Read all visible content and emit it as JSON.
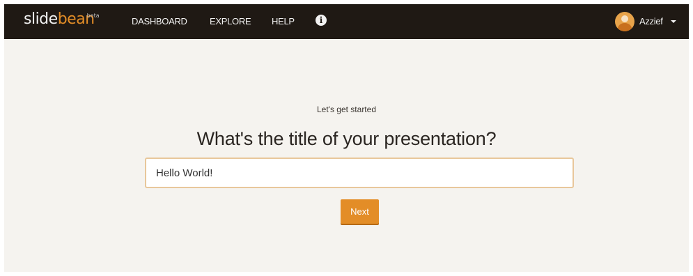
{
  "brand": {
    "logo_part1": "slide",
    "logo_part2": "bean",
    "badge": "beta"
  },
  "nav": {
    "items": [
      {
        "label": "DASHBOARD"
      },
      {
        "label": "EXPLORE"
      },
      {
        "label": "HELP"
      }
    ],
    "info_icon": "info-circle-icon",
    "user_name": "Azzief"
  },
  "main": {
    "subtitle": "Let's get started",
    "heading": "What's the title of your presentation?",
    "title_input_value": "Hello World!",
    "next_label": "Next"
  },
  "colors": {
    "navbar": "#1f1914",
    "accent": "#e38d27",
    "background": "#f5f3ef",
    "input_border": "#e8c79b"
  }
}
